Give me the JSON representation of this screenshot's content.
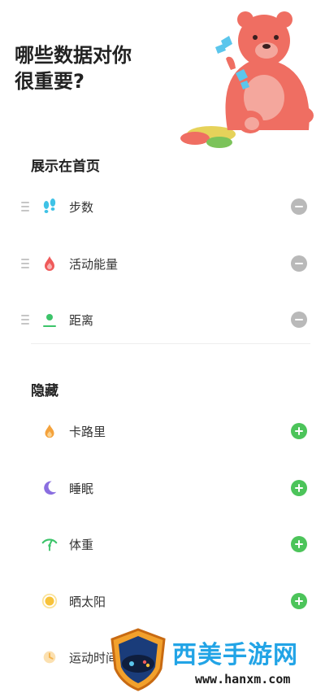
{
  "header": {
    "title": "哪些数据对你\n很重要?"
  },
  "shown_section": {
    "title": "展示在首页",
    "items": [
      {
        "label": "步数",
        "icon": "footsteps-icon",
        "color": "#3fc2e6"
      },
      {
        "label": "活动能量",
        "icon": "flame-icon",
        "color": "#ef5a5a"
      },
      {
        "label": "距离",
        "icon": "location-pin-icon",
        "color": "#3cc46a"
      }
    ]
  },
  "hidden_section": {
    "title": "隐藏",
    "items": [
      {
        "label": "卡路里",
        "icon": "fire-icon",
        "color": "#f4a23c"
      },
      {
        "label": "睡眠",
        "icon": "moon-icon",
        "color": "#8a6ee0"
      },
      {
        "label": "体重",
        "icon": "scale-icon",
        "color": "#3cc46a"
      },
      {
        "label": "晒太阳",
        "icon": "sun-icon",
        "color": "#f7c23a"
      },
      {
        "label": "运动时间",
        "icon": "clock-icon",
        "color": "#f4b24a"
      }
    ]
  },
  "watermark": {
    "text": "西美手游网",
    "url": "www.hanxm.com"
  },
  "colors": {
    "add": "#4cc45a",
    "remove": "#b9b9b9",
    "bear": "#ef6e62"
  }
}
